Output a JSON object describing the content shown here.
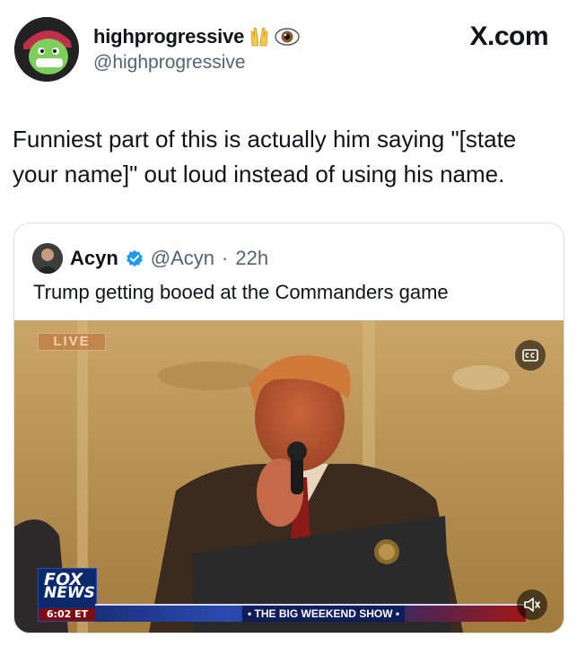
{
  "author": {
    "name": "highprogressive",
    "handle": "@highprogressive",
    "emojis": [
      "raised-hands-icon",
      "eye-icon"
    ]
  },
  "watermark": "X.com",
  "tweet": {
    "text": "Funniest part of this is actually him saying \"[state your name]\" out loud instead of using his name."
  },
  "quote": {
    "name": "Acyn",
    "handle": "@Acyn",
    "separator": "·",
    "time": "22h",
    "text": "Trump getting booed at the Commanders game",
    "video": {
      "live_label": "LIVE",
      "network_line1": "FOX",
      "network_line2": "NEWS",
      "clock": "6:02 ET",
      "banner": "• THE BIG WEEKEND SHOW •",
      "cc_icon": "closed-captions-icon",
      "volume_icon": "volume-icon"
    }
  },
  "colors": {
    "text": "#0f1419",
    "muted": "#536471",
    "verified": "#1d9bf0",
    "border": "#d9dde1"
  }
}
